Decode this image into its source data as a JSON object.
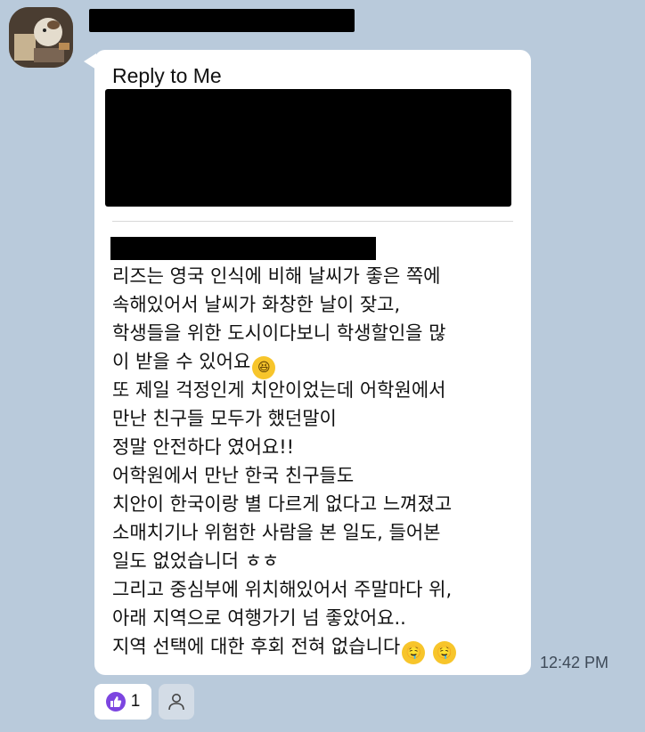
{
  "message": {
    "reply_header": "Reply to Me",
    "lines": [
      "리즈는 영국 인식에 비해 날씨가 좋은 쪽에",
      "속해있어서 날씨가 화창한 날이 잦고,",
      "학생들을 위한 도시이다보니 학생할인을  많",
      "이 받을 수 있어요",
      "또 제일 걱정인게 치안이었는데 어학원에서",
      "만난 친구들 모두가 했던말이",
      "정말 안전하다 였어요!!",
      "어학원에서 만난 한국 친구들도",
      "치안이 한국이랑 별 다르게 없다고 느껴졌고",
      "소매치기나 위험한 사람을 본 일도, 들어본",
      "일도 없었습니더 ㅎㅎ",
      "그리고 중심부에 위치해있어서 주말마다 위,",
      "아래 지역으로 여행가기 넘 좋았어요..",
      "지역 선택에 대한 후회 전혀 없습니다"
    ],
    "emoji_laugh": "laughing-face-icon",
    "emoji_drool": "drooling-face-icon",
    "timestamp": "12:42 PM"
  },
  "reaction": {
    "icon": "thumbs-up-icon",
    "count": "1",
    "accent_color": "#7c45e0"
  },
  "colors": {
    "background": "#b9cadb",
    "bubble": "#ffffff"
  }
}
